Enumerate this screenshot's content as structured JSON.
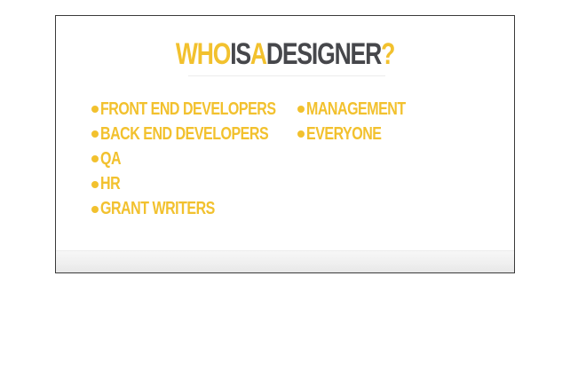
{
  "slide": {
    "title_parts": [
      {
        "text": "WHO",
        "color": "#f2c12e"
      },
      {
        "text": "IS",
        "color": "#46474b"
      },
      {
        "text": "A",
        "color": "#f2c12e"
      },
      {
        "text": "DESIGNER",
        "color": "#46474b"
      },
      {
        "text": "?",
        "color": "#f2c12e"
      }
    ],
    "left_items": [
      "FRONT END DEVELOPERS",
      "BACK END DEVELOPERS",
      "QA",
      "HR",
      "GRANT WRITERS"
    ],
    "right_items": [
      "MANAGEMENT",
      "EVERYONE"
    ]
  },
  "colors": {
    "accent": "#f2c12e",
    "dark": "#46474b"
  }
}
